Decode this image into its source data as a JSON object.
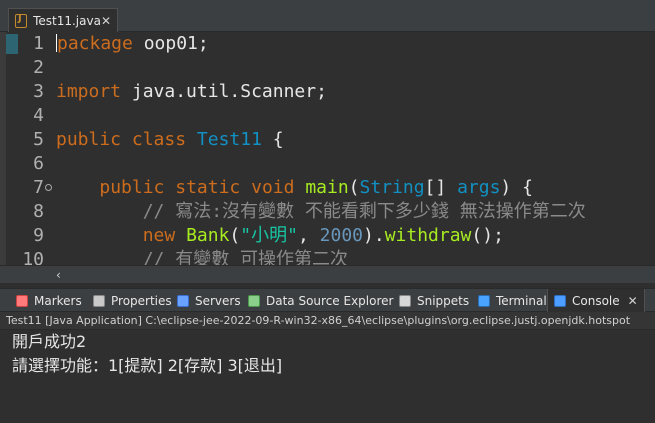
{
  "editor_tab": {
    "label": "Test11.java",
    "close": "✕",
    "icon": "java-file-icon"
  },
  "code": {
    "lines": [
      {
        "n": "1",
        "parts": [
          [
            "kw",
            "package"
          ],
          [
            "",
            " oop01;"
          ]
        ]
      },
      {
        "n": "2",
        "parts": []
      },
      {
        "n": "3",
        "parts": [
          [
            "kw",
            "import"
          ],
          [
            "",
            " java.util.Scanner;"
          ]
        ]
      },
      {
        "n": "4",
        "parts": []
      },
      {
        "n": "5",
        "parts": [
          [
            "kw",
            "public"
          ],
          [
            "",
            " "
          ],
          [
            "kw",
            "class"
          ],
          [
            "",
            " "
          ],
          [
            "cls",
            "Test11"
          ],
          [
            "",
            " {"
          ]
        ]
      },
      {
        "n": "6",
        "parts": []
      },
      {
        "n": "7",
        "parts": [
          [
            "",
            "    "
          ],
          [
            "kw",
            "public"
          ],
          [
            "",
            " "
          ],
          [
            "kw",
            "static"
          ],
          [
            "",
            " "
          ],
          [
            "kw",
            "void"
          ],
          [
            "",
            " "
          ],
          [
            "m",
            "main"
          ],
          [
            "",
            "("
          ],
          [
            "cls",
            "String"
          ],
          [
            "",
            "[] "
          ],
          [
            "cls",
            "args"
          ],
          [
            "",
            ") {"
          ]
        ]
      },
      {
        "n": "8",
        "parts": [
          [
            "",
            "        "
          ],
          [
            "comment",
            "// 寫法:沒有變數 不能看剩下多少錢 無法操作第二次"
          ]
        ]
      },
      {
        "n": "9",
        "parts": [
          [
            "",
            "        "
          ],
          [
            "kw",
            "new"
          ],
          [
            "",
            " "
          ],
          [
            "m",
            "Bank"
          ],
          [
            "",
            "("
          ],
          [
            "str",
            "\"小明\""
          ],
          [
            "",
            ", "
          ],
          [
            "num",
            "2000"
          ],
          [
            "",
            ")."
          ],
          [
            "m",
            "withdraw"
          ],
          [
            "",
            "();"
          ]
        ]
      },
      {
        "n": "10",
        "parts": [
          [
            "",
            "        "
          ],
          [
            "comment",
            "// 有變數 可操作第二次"
          ]
        ]
      }
    ]
  },
  "scrollbar": {
    "left_arrow": "‹"
  },
  "views": {
    "tabs": [
      {
        "label": "Markers",
        "icon": "markers-icon"
      },
      {
        "label": "Properties",
        "icon": "properties-icon"
      },
      {
        "label": "Servers",
        "icon": "servers-icon"
      },
      {
        "label": "Data Source Explorer",
        "icon": "data-source-explorer-icon"
      },
      {
        "label": "Snippets",
        "icon": "snippets-icon"
      },
      {
        "label": "Terminal",
        "icon": "terminal-icon"
      },
      {
        "label": "Console",
        "icon": "console-icon",
        "active": true,
        "close": "✕"
      }
    ]
  },
  "console": {
    "header": "Test11 [Java Application] C:\\eclipse-jee-2022-09-R-win32-x86_64\\eclipse\\plugins\\org.eclipse.justj.openjdk.hotspot",
    "lines": [
      "開戶成功2",
      "請選擇功能：1[提款] 2[存款] 3[退出]"
    ]
  }
}
